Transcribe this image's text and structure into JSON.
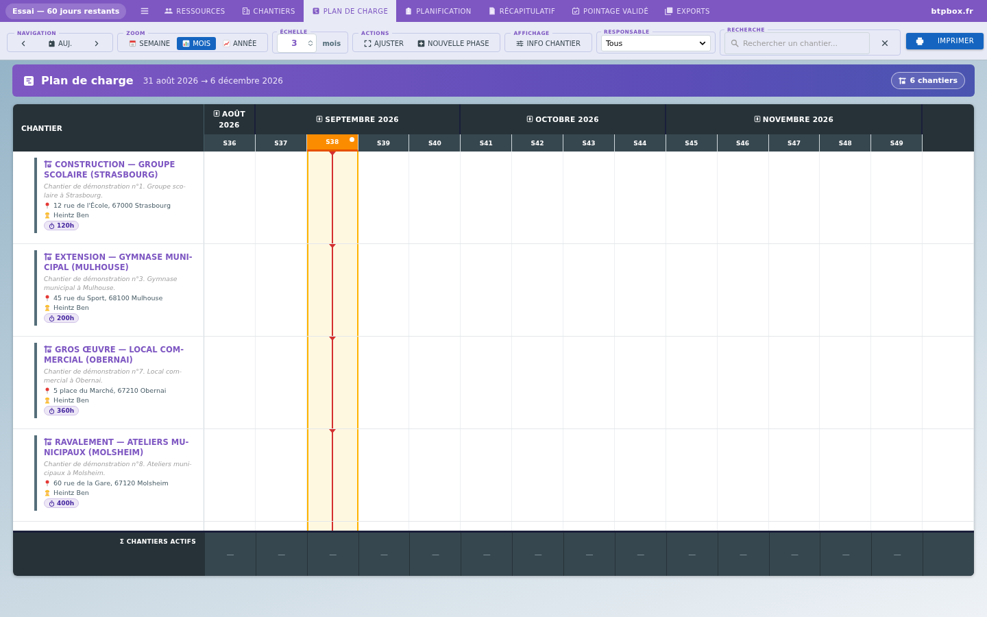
{
  "topbar": {
    "trial_badge": "Essai — 60 jours restants",
    "tabs": [
      {
        "label": "RESSOURCES",
        "selected": false
      },
      {
        "label": "CHANTIERS",
        "selected": false
      },
      {
        "label": "PLAN DE CHARGE",
        "selected": true
      },
      {
        "label": "PLANIFICATION",
        "selected": false
      },
      {
        "label": "RÉCAPITULATIF",
        "selected": false
      },
      {
        "label": "POINTAGE VALIDÉ",
        "selected": false
      },
      {
        "label": "EXPORTS",
        "selected": false
      }
    ],
    "brand": "btpbox.fr"
  },
  "toolbar": {
    "navigation": {
      "legend": "NAVIGATION",
      "today": "AUJ."
    },
    "zoom": {
      "legend": "ZOOM",
      "options": [
        {
          "label": "SEMAINE",
          "selected": false
        },
        {
          "label": "MOIS",
          "selected": true
        },
        {
          "label": "ANNÉE",
          "selected": false
        }
      ]
    },
    "scale": {
      "legend": "ÉCHELLE",
      "value": "3",
      "unit": "mois"
    },
    "actions": {
      "legend": "ACTIONS",
      "buttons": [
        "AJUSTER",
        "NOUVELLE PHASE"
      ]
    },
    "display": {
      "legend": "AFFICHAGE",
      "button": "INFO CHANTIER"
    },
    "manager": {
      "legend": "RESPONSABLE",
      "value": "Tous"
    },
    "search": {
      "legend": "RECHERCHE",
      "placeholder": "Rechercher un chantier..."
    },
    "print": "IMPRIMER"
  },
  "banner": {
    "title": "Plan de charge",
    "range": "31 août 2026 → 6 décembre 2026",
    "count": "6 chantiers"
  },
  "grid": {
    "first_column": "CHANTIER",
    "months": [
      {
        "label": "AOÛT 2026",
        "weeks": [
          {
            "label": "S36",
            "current": false
          }
        ]
      },
      {
        "label": "SEPTEMBRE 2026",
        "weeks": [
          {
            "label": "S37",
            "current": false
          },
          {
            "label": "S38",
            "current": true
          },
          {
            "label": "S39",
            "current": false
          },
          {
            "label": "S40",
            "current": false
          }
        ]
      },
      {
        "label": "OCTOBRE 2026",
        "weeks": [
          {
            "label": "S41",
            "current": false
          },
          {
            "label": "S42",
            "current": false
          },
          {
            "label": "S43",
            "current": false
          },
          {
            "label": "S44",
            "current": false
          }
        ]
      },
      {
        "label": "NOVEMBRE 2026",
        "weeks": [
          {
            "label": "S45",
            "current": false
          },
          {
            "label": "S46",
            "current": false
          },
          {
            "label": "S47",
            "current": false
          },
          {
            "label": "S48",
            "current": false
          },
          {
            "label": "S49",
            "current": false
          }
        ]
      }
    ],
    "rows": [
      {
        "title": "CONSTRUCTION — GROUPE SCOLAIRE (STRASBOURG)",
        "description": "Chantier de démonstration n°1. Groupe sco-laire à Strasbourg.",
        "address": "12 rue de l'École, 67000 Strasbourg",
        "manager": "Heintz Ben",
        "hours": "120h"
      },
      {
        "title": "EXTENSION — GYMNASE MUNI-CIPAL (MULHOUSE)",
        "description": "Chantier de démonstration n°3. Gymnase municipal à Mulhouse.",
        "address": "45 rue du Sport, 68100 Mulhouse",
        "manager": "Heintz Ben",
        "hours": "200h"
      },
      {
        "title": "GROS ŒUVRE — LOCAL COM-MERCIAL (OBERNAI)",
        "description": "Chantier de démonstration n°7. Local com-mercial à Obernai.",
        "address": "5 place du Marché, 67210 Obernai",
        "manager": "Heintz Ben",
        "hours": "360h"
      },
      {
        "title": "RAVALEMENT — ATELIERS MU-NICIPAUX (MOLSHEIM)",
        "description": "Chantier de démonstration n°8. Ateliers muni-cipaux à Molsheim.",
        "address": "60 rue de la Gare, 67120 Molsheim",
        "manager": "Heintz Ben",
        "hours": "400h"
      }
    ],
    "footer": {
      "label": "Σ CHANTIERS ACTIFS",
      "cells": [
        "—",
        "—",
        "—",
        "—",
        "—",
        "—",
        "—",
        "—",
        "—",
        "—",
        "—",
        "—",
        "—",
        "—"
      ]
    }
  }
}
